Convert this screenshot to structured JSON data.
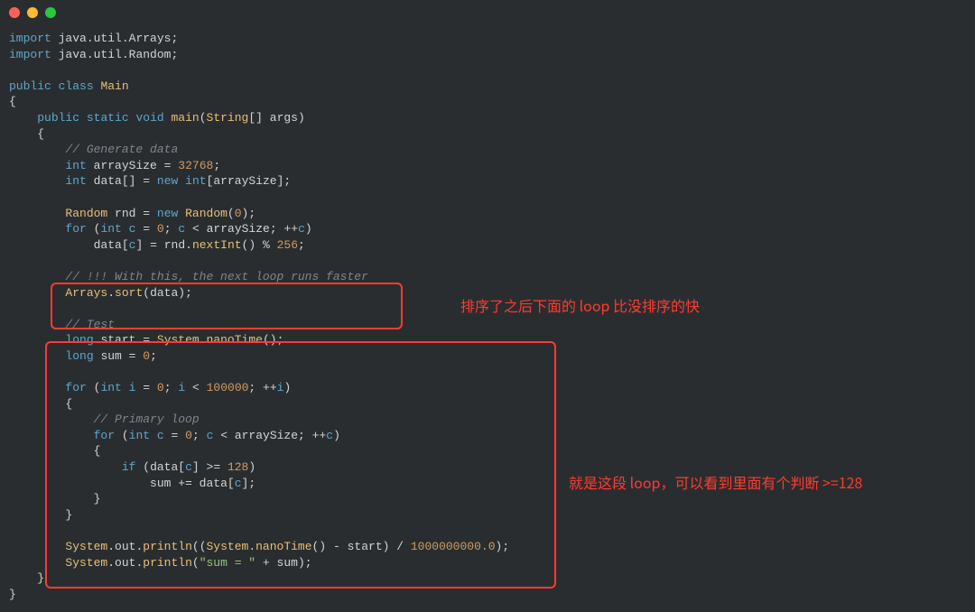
{
  "window": {
    "close_label": "close",
    "min_label": "minimize",
    "max_label": "maximize"
  },
  "colors": {
    "annotation": "#ff3b30"
  },
  "annotations": {
    "note1": "排序了之后下面的 loop 比没排序的快",
    "note2": "就是这段 loop，可以看到里面有个判断 >=128"
  },
  "code": {
    "import1_kw": "import",
    "import1_pkg": "java.util.Arrays",
    "import2_kw": "import",
    "import2_pkg": "java.util.Random",
    "public_kw": "public",
    "class_kw": "class",
    "class_name": "Main",
    "lbrace": "{",
    "rbrace": "}",
    "static_kw": "static",
    "void_kw": "void",
    "main_fn": "main",
    "string_type": "String",
    "args_id": "args",
    "cmt_generate": "// Generate data",
    "int_kw": "int",
    "arraySize_id": "arraySize",
    "arraySize_val": "32768",
    "data_id": "data",
    "new_kw": "new",
    "random_type": "Random",
    "rnd_id": "rnd",
    "zero": "0",
    "for_kw": "for",
    "c_id": "c",
    "nextInt_fn": "nextInt",
    "mod256": "256",
    "cmt_withthis": "// !!! With this, the next loop runs faster",
    "arrays_type": "Arrays",
    "sort_fn": "sort",
    "cmt_test": "// Test",
    "long_kw": "long",
    "start_id": "start",
    "system_type": "System",
    "nanoTime_fn": "nanoTime",
    "sum_id": "sum",
    "i_id": "i",
    "hundredk": "100000",
    "cmt_primary": "// Primary loop",
    "if_kw": "if",
    "ge128": "128",
    "plus_eq": "+=",
    "out_id": "out",
    "println_fn": "println",
    "billion": "1000000000.0",
    "sumstr": "\"sum = \"",
    "plus": "+",
    "minus": "-",
    "eq": "=",
    "lt": "<",
    "ge": ">=",
    "inc": "++",
    "pct": "%",
    "div": "/",
    "semi": ";",
    "comma": ",",
    "lp": "(",
    "rp": ")",
    "lb": "[",
    "rb": "]",
    "dot": "."
  }
}
